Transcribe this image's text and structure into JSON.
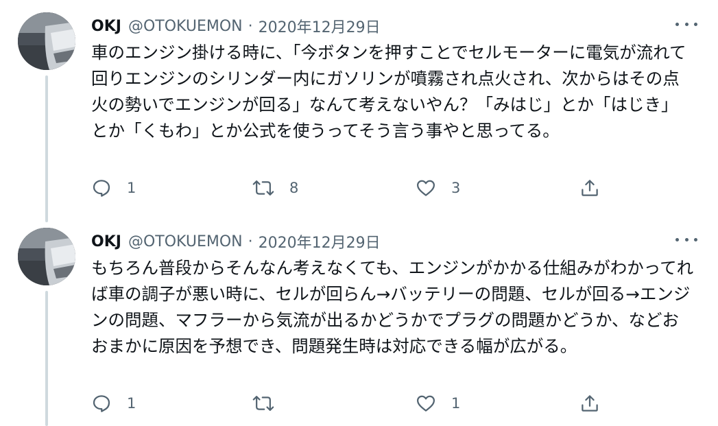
{
  "tweets": [
    {
      "name": "OKJ",
      "handle": "@OTOKUEMON",
      "separator": "·",
      "date": "2020年12月29日",
      "text": "車のエンジン掛ける時に、「今ボタンを押すことでセルモーターに電気が流れて回りエンジンのシリンダー内にガソリンが噴霧され点火され、次からはその点火の勢いでエンジンが回る」なんて考えないやん？「みはじ」とか「はじき」とか「くもわ」とか公式を使うってそう言う事やと思ってる。",
      "reply_count": "1",
      "retweet_count": "8",
      "like_count": "3",
      "share_count": ""
    },
    {
      "name": "OKJ",
      "handle": "@OTOKUEMON",
      "separator": "·",
      "date": "2020年12月29日",
      "text": "もちろん普段からそんなん考えなくても、エンジンがかかる仕組みがわかってれば車の調子が悪い時に、セルが回らん→バッテリーの問題、セルが回る→エンジンの問題、マフラーから気流が出るかどうかでプラグの問題かどうか、などおおまかに原因を予想でき、問題発生時は対応できる幅が広がる。",
      "reply_count": "1",
      "retweet_count": "",
      "like_count": "1",
      "share_count": ""
    }
  ],
  "icons": {
    "reply": "reply-icon",
    "retweet": "retweet-icon",
    "like": "like-icon",
    "share": "share-icon",
    "more": "more-options-icon"
  },
  "colors": {
    "text": "#0f1419",
    "muted": "#536471",
    "thread_line": "#cfd9de",
    "background": "#ffffff"
  }
}
